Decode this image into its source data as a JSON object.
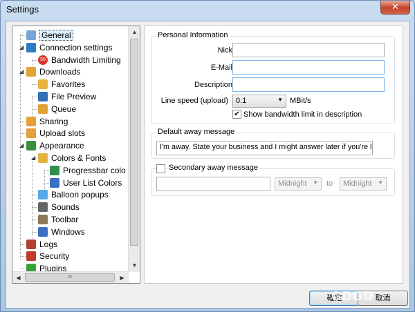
{
  "window": {
    "title": "Settings",
    "close_glyph": "✕"
  },
  "tree": {
    "items": [
      {
        "label": "General",
        "icon": "general-icon",
        "color": "#7aa6d6",
        "selected": true
      },
      {
        "label": "Connection settings",
        "icon": "globe-icon",
        "color": "#2c7bc4"
      },
      {
        "label": "Bandwidth Limiting",
        "icon": "speed-limit-icon",
        "color": "#d9362c",
        "badge": "50"
      },
      {
        "label": "Downloads",
        "icon": "downloads-icon",
        "color": "#e3a13a"
      },
      {
        "label": "Favorites",
        "icon": "favorites-icon",
        "color": "#e6b43f"
      },
      {
        "label": "File Preview",
        "icon": "preview-icon",
        "color": "#2f6fb7"
      },
      {
        "label": "Queue",
        "icon": "queue-icon",
        "color": "#e3a13a"
      },
      {
        "label": "Sharing",
        "icon": "sharing-icon",
        "color": "#e3a13a"
      },
      {
        "label": "Upload slots",
        "icon": "upload-slots-icon",
        "color": "#e3a13a"
      },
      {
        "label": "Appearance",
        "icon": "appearance-icon",
        "color": "#3a8f3a"
      },
      {
        "label": "Colors & Fonts",
        "icon": "palette-icon",
        "color": "#e3b33f"
      },
      {
        "label": "Progressbar colo",
        "icon": "progressbar-icon",
        "color": "#2f8f4f"
      },
      {
        "label": "User List Colors",
        "icon": "userlist-icon",
        "color": "#3a6fc4"
      },
      {
        "label": "Balloon popups",
        "icon": "balloon-icon",
        "color": "#56a8e6"
      },
      {
        "label": "Sounds",
        "icon": "sounds-icon",
        "color": "#666666"
      },
      {
        "label": "Toolbar",
        "icon": "tools-icon",
        "color": "#8a7a5a"
      },
      {
        "label": "Windows",
        "icon": "windows-icon",
        "color": "#3a6fc4"
      },
      {
        "label": "Logs",
        "icon": "logs-icon",
        "color": "#b3402f"
      },
      {
        "label": "Security",
        "icon": "security-icon",
        "color": "#c23a2a"
      },
      {
        "label": "Plugins",
        "icon": "plugins-icon",
        "color": "#3aa03a"
      }
    ],
    "hscroll_grip": "III"
  },
  "personal": {
    "title": "Personal Information",
    "nick_label": "Nick",
    "nick_value": "",
    "email_label": "E-Mail",
    "email_value": "",
    "description_label": "Description",
    "description_value": "",
    "line_speed_label": "Line speed (upload)",
    "line_speed_value": "0.1",
    "line_speed_unit": "MBit/s",
    "show_bandwidth_label": "Show bandwidth limit in description",
    "show_bandwidth_checked": true
  },
  "away": {
    "title": "Default away message",
    "message": "I'm away. State your business and I might answer later if you're lucky."
  },
  "secondary": {
    "title": "Secondary away message",
    "checked": false,
    "message": "",
    "from_value": "Midnight",
    "to_label": "to",
    "to_value": "Midnight"
  },
  "buttons": {
    "ok": "確定",
    "cancel": "取消"
  },
  "watermark": "GDGD"
}
